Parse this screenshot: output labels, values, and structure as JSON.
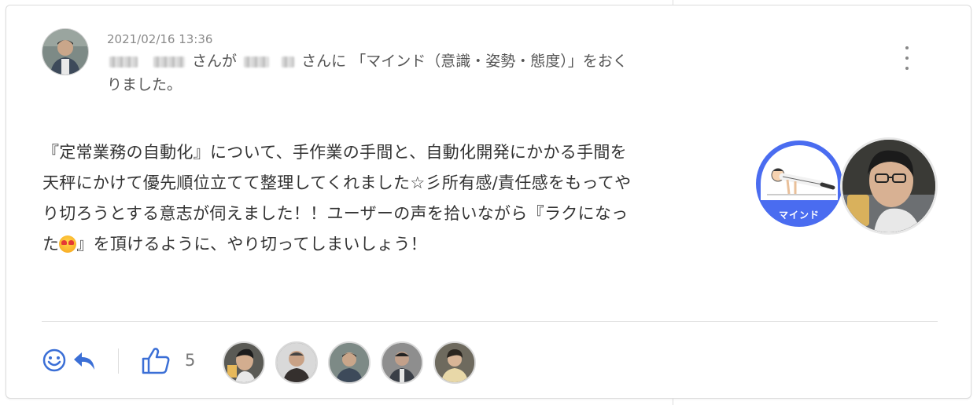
{
  "post": {
    "timestamp": "2021/02/16 13:36",
    "sender_suffix": "さんが",
    "receiver_suffix": "さんに",
    "action_text": "「マインド（意識・姿勢・態度）」をおく",
    "action_text_cont": "りました。",
    "message_part1": "『定常業務の自動化』について、手作業の手間と、自動化開発にかかる手間を\n天秤にかけて優先順位立てて整理してくれました☆彡所有感/責任感をもってや\nり切ろうとする意志が伺えました！！ユーザーの声を拾いながら『ラクになっ\nた",
    "message_part2": "』を頂けるように、やり切ってしまいしょう！",
    "badge_label": "マインド"
  },
  "footer": {
    "like_count": "5"
  },
  "colors": {
    "accent": "#3b6fd6",
    "badge_blue": "#4a6cf0",
    "text": "#333333",
    "meta": "#8a8a8a"
  },
  "icons": {
    "reaction": "smiley-icon",
    "reply": "reply-arrow-icon",
    "like": "thumbs-up-icon",
    "more": "vertical-ellipsis-icon",
    "emoji": "heart-eyes-emoji"
  }
}
